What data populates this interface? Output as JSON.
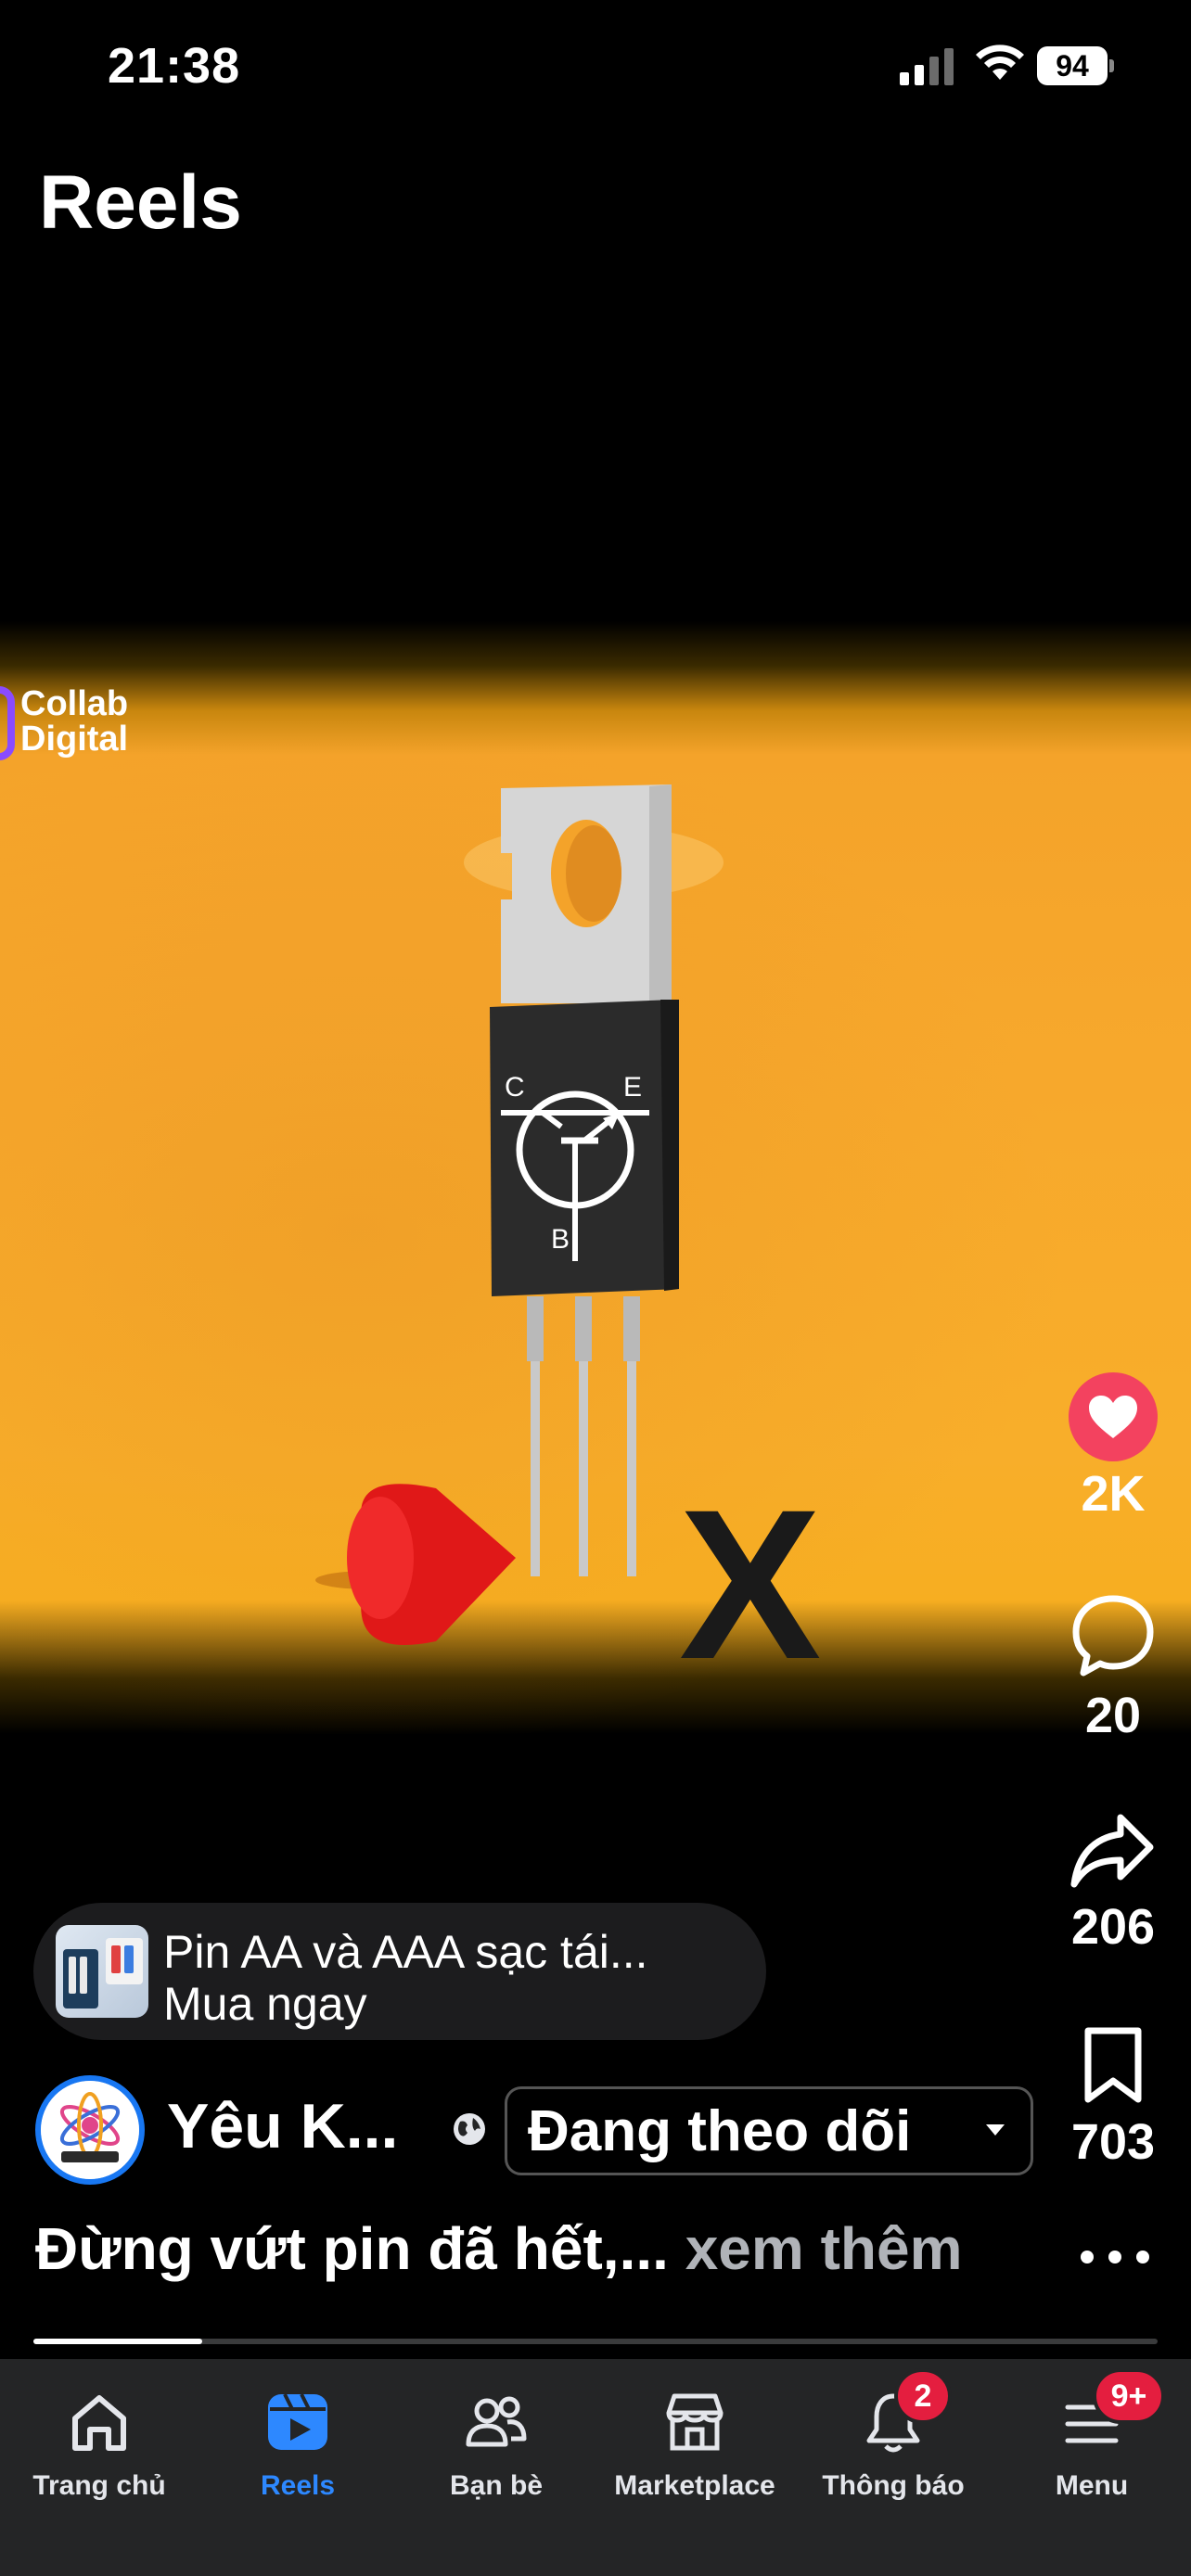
{
  "status_bar": {
    "time": "21:38",
    "battery": "94"
  },
  "header": {
    "title": "Reels"
  },
  "video": {
    "watermark_line1": "Collab",
    "watermark_line2": "Digital",
    "pin_labels": {
      "c": "C",
      "e": "E",
      "b": "B"
    },
    "x_mark": "X"
  },
  "actions": {
    "likes": "2K",
    "comments": "20",
    "shares": "206",
    "saves": "703"
  },
  "ad": {
    "title": "Pin AA và AAA sạc tái...",
    "cta": "Mua ngay"
  },
  "author": {
    "name": "Yêu K...",
    "follow_label": "Đang theo dõi"
  },
  "caption": {
    "text": "Đừng vứt pin đã hết,...",
    "more": "xem thêm"
  },
  "progress": {
    "fraction": 0.15
  },
  "nav": {
    "items": [
      {
        "label": "Trang chủ",
        "icon": "home-icon"
      },
      {
        "label": "Reels",
        "icon": "reels-icon",
        "active": true
      },
      {
        "label": "Bạn bè",
        "icon": "friends-icon"
      },
      {
        "label": "Marketplace",
        "icon": "marketplace-icon"
      },
      {
        "label": "Thông báo",
        "icon": "bell-icon",
        "badge": "2"
      },
      {
        "label": "Menu",
        "icon": "menu-icon",
        "badge": "9+"
      }
    ]
  },
  "colors": {
    "accent": "#2d88ff",
    "like": "#f3425f",
    "badge": "#e41e3f",
    "video_bg": "#f7a82c"
  }
}
